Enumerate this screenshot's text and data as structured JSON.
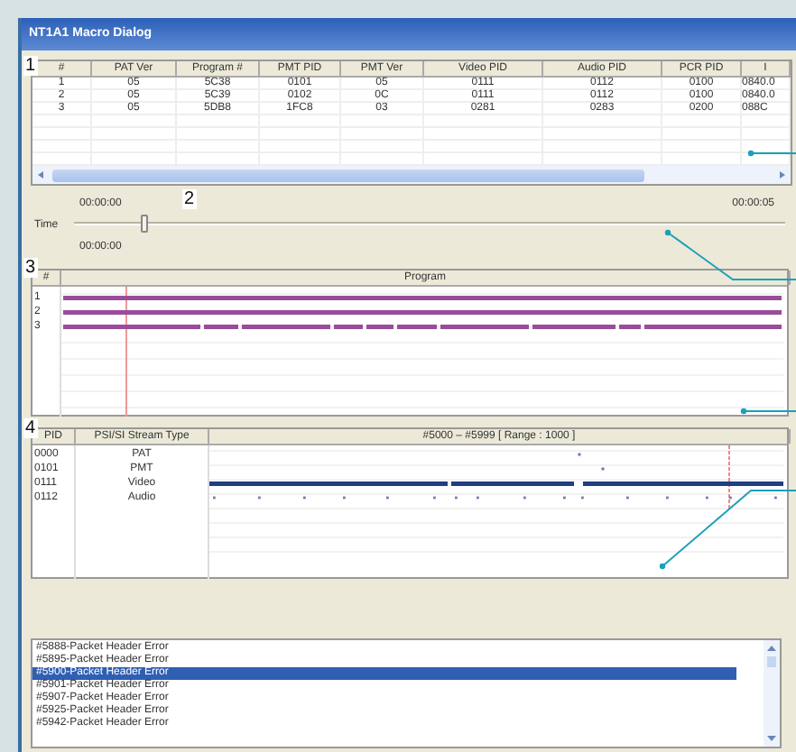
{
  "window": {
    "title": "NT1A1 Macro Dialog"
  },
  "program_table": {
    "callout": "1",
    "columns": [
      "#",
      "PAT Ver",
      "Program #",
      "PMT PID",
      "PMT Ver",
      "Video PID",
      "Audio PID",
      "PCR PID",
      "I"
    ],
    "rows": [
      [
        "1",
        "05",
        "5C38",
        "0101",
        "05",
        "0111",
        "0112",
        "0100",
        "0840.0"
      ],
      [
        "2",
        "05",
        "5C39",
        "0102",
        "0C",
        "0111",
        "0112",
        "0100",
        "0840.0"
      ],
      [
        "3",
        "05",
        "5DB8",
        "1FC8",
        "03",
        "0281",
        "0283",
        "0200",
        "088C"
      ]
    ]
  },
  "time": {
    "callout": "2",
    "label": "Time",
    "start_top": "00:00:00",
    "start_bottom": "00:00:00",
    "end": "00:00:05",
    "level": 0.1
  },
  "program_tracks": {
    "callout": "3",
    "columns": [
      "#",
      "Program"
    ],
    "rows": [
      {
        "number": "1",
        "kind": "solid"
      },
      {
        "number": "2",
        "kind": "solid"
      },
      {
        "number": "3",
        "kind": "dashed"
      }
    ]
  },
  "stream_table": {
    "callout": "4",
    "columns": [
      "PID",
      "PSI/SI Stream Type",
      "#5000 – #5999 [ Range : 1000 ]"
    ],
    "rows": [
      {
        "pid": "0000",
        "type": "PAT",
        "kind": "point"
      },
      {
        "pid": "0101",
        "type": "PMT",
        "kind": "point"
      },
      {
        "pid": "0111",
        "type": "Video",
        "kind": "bar"
      },
      {
        "pid": "0112",
        "type": "Audio",
        "kind": "ticks"
      }
    ]
  },
  "error_log": {
    "items": [
      {
        "text": "#5888-Packet Header Error",
        "selected": false
      },
      {
        "text": "#5895-Packet Header Error",
        "selected": false
      },
      {
        "text": "#5900-Packet Header Error",
        "selected": true
      },
      {
        "text": "#5901-Packet Header Error",
        "selected": false
      },
      {
        "text": "#5907-Packet Header Error",
        "selected": false
      },
      {
        "text": "#5925-Packet Header Error",
        "selected": false
      },
      {
        "text": "#5942-Packet Header Error",
        "selected": false
      }
    ]
  }
}
